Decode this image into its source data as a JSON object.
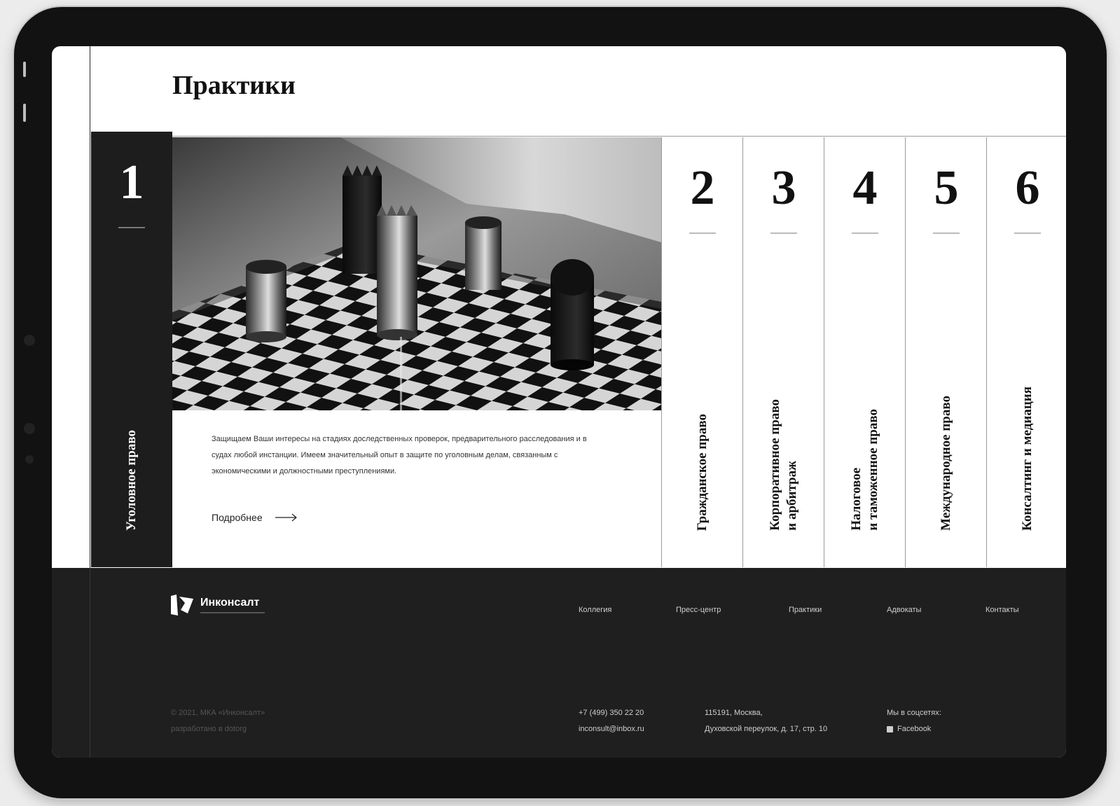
{
  "page_title": "Практики",
  "practices": [
    {
      "number": "1",
      "title": "Уголовное право",
      "active": true
    },
    {
      "number": "2",
      "title": "Гражданское право"
    },
    {
      "number": "3",
      "title": "Корпоративное право\nи арбитраж"
    },
    {
      "number": "4",
      "title": "Налоговое\nи таможенное право"
    },
    {
      "number": "5",
      "title": "Международное право"
    },
    {
      "number": "6",
      "title": "Консалтинг и медиация"
    }
  ],
  "active_card": {
    "description": "Защищаем Ваши интересы на стадиях доследственных проверок, предварительного расследования и в судах любой инстанции. Имеем значительный опыт в защите по уголовным делам, связанным с экономическими и должностными преступлениями.",
    "more_label": "Подробнее"
  },
  "footer": {
    "logo_name": "Инконсалт",
    "nav": [
      "Коллегия",
      "Пресс-центр",
      "Практики",
      "Адвокаты",
      "Контакты"
    ],
    "copyright": "© 2021, МКА «Инконсалт»",
    "developer": "разработано в dotorg",
    "phone": "+7 (499) 350 22 20",
    "email": "inconsult@inbox.ru",
    "address_line1": "115191, Москва,",
    "address_line2": "Духовской переулок, д. 17, стр. 10",
    "social_title": "Мы в соцсетях:",
    "social_link": "Facebook"
  },
  "colors": {
    "dark": "#1d1d1d",
    "footer": "#1f1f1f",
    "accent": "#ffffff"
  },
  "icons": {
    "arrow": "arrow-right-icon",
    "facebook": "facebook-icon",
    "logo": "logo-icon"
  }
}
